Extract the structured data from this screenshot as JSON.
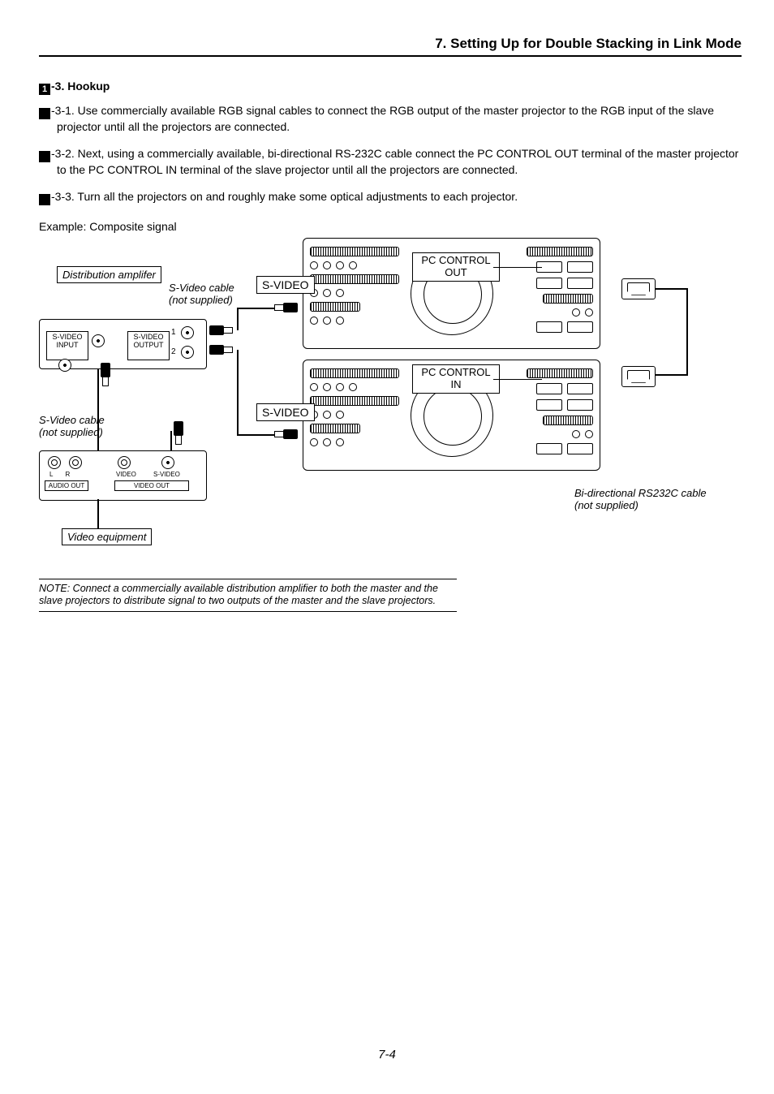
{
  "header": {
    "title": "7. Setting Up for Double Stacking in Link Mode"
  },
  "section": {
    "num": "1",
    "heading_suffix": "-3. Hookup"
  },
  "paras": {
    "p1": {
      "num": "1",
      "lead": "-3-1.",
      "text": " Use commercially available RGB signal cables to connect the RGB output of the master projector to the RGB input of the slave projector until all the projectors are connected."
    },
    "p2": {
      "num": "1",
      "lead": "-3-2.",
      "text": " Next, using a commercially available, bi-directional RS-232C cable connect the PC CONTROL OUT terminal of the master projector to the PC CONTROL IN terminal of the slave projector until all the projectors are connected."
    },
    "p3": {
      "num": "1",
      "lead": "-3-3.",
      "text": " Turn all the projectors on and roughly make some optical adjustments to each projector."
    }
  },
  "figure": {
    "example_label": "Example: Composite signal",
    "distribution_amp": "Distribution amplifer",
    "svideo_cable": "S-Video cable",
    "not_supplied": "(not supplied)",
    "svideo": "S-VIDEO",
    "pc_control_out": "PC CONTROL\nOUT",
    "pc_control_in": "PC CONTROL\nIN",
    "svideo_input": "S-VIDEO\nINPUT",
    "svideo_output": "S-VIDEO\nOUTPUT",
    "one": "1",
    "two": "2",
    "audio_out": "AUDIO OUT",
    "video_out": "VIDEO OUT",
    "L": "L",
    "R": "R",
    "video": "VIDEO",
    "svideo_small": "S-VIDEO",
    "video_equipment": "Video equipment",
    "rs232": "Bi-directional RS232C cable\n(not supplied)"
  },
  "note": "NOTE: Connect a commercially available distribution amplifier to both the master and the slave projectors to distribute signal to two outputs of the master and the slave projectors.",
  "page_number": "7-4"
}
